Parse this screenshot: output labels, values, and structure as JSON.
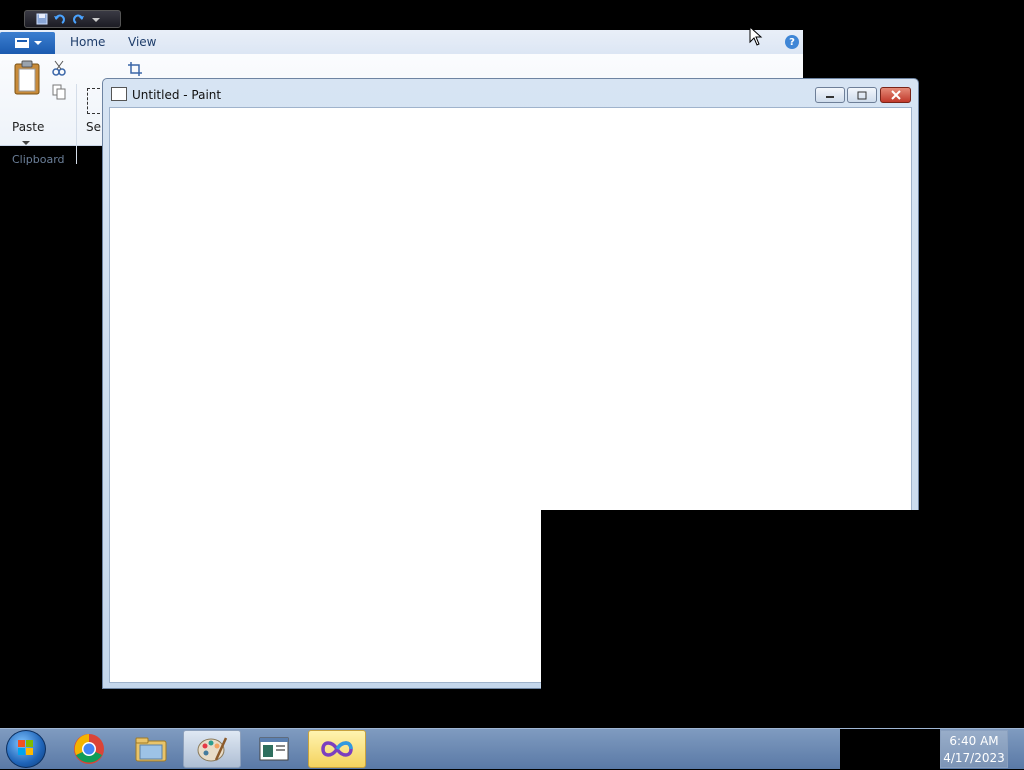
{
  "bg_paint": {
    "tabs": [
      "Home",
      "View"
    ],
    "paste_label": "Paste",
    "select_label": "Sel",
    "clipboard_group_label": "Clipboard",
    "color1": "#ffd59a",
    "palette": [
      "#000000",
      "#7f7f7f",
      "#880015",
      "#ed1c24",
      "#ff7f27",
      "#fff200",
      "#22b14c",
      "#00a2e8",
      "#3f48cc",
      "#a349a4"
    ]
  },
  "fg_paint": {
    "title": "Untitled - Paint"
  },
  "taskbar": {
    "apps": [
      "Google Chrome",
      "Windows Explorer",
      "Paint",
      "Task window",
      "Visual Studio"
    ],
    "clock_time": "6:40 AM",
    "clock_date": "4/17/2023"
  },
  "icons": {
    "save": "save-icon",
    "undo": "undo-icon",
    "redo": "redo-icon",
    "help": "help-icon",
    "close": "close-icon"
  }
}
